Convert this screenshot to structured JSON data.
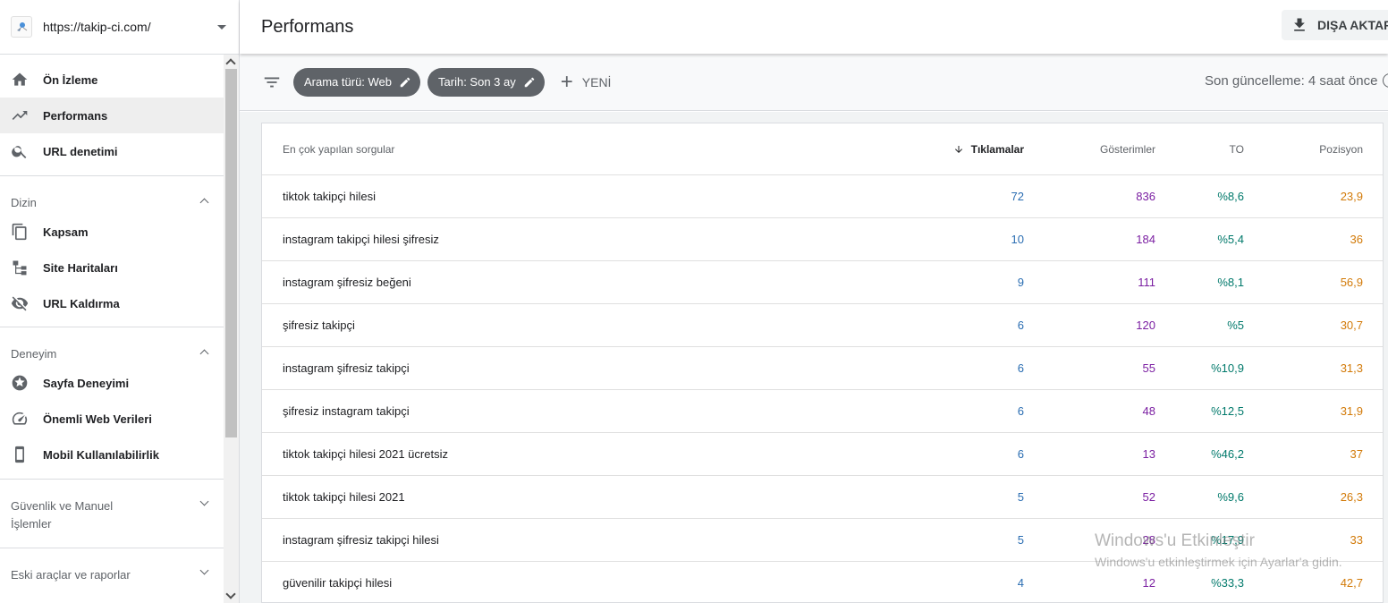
{
  "property": {
    "url": "https://takip-ci.com/"
  },
  "nav": {
    "top": [
      {
        "label": "Ön İzleme",
        "icon": "home-icon"
      },
      {
        "label": "Performans",
        "icon": "trending-icon"
      },
      {
        "label": "URL denetimi",
        "icon": "search-icon"
      }
    ],
    "sections": [
      {
        "title": "Dizin",
        "expanded": true,
        "items": [
          {
            "label": "Kapsam",
            "icon": "pages-icon"
          },
          {
            "label": "Site Haritaları",
            "icon": "sitemap-icon"
          },
          {
            "label": "URL Kaldırma",
            "icon": "eye-off-icon"
          }
        ]
      },
      {
        "title": "Deneyim",
        "expanded": true,
        "items": [
          {
            "label": "Sayfa Deneyimi",
            "icon": "star-circle-icon"
          },
          {
            "label": "Önemli Web Verileri",
            "icon": "gauge-icon"
          },
          {
            "label": "Mobil Kullanılabilirlik",
            "icon": "phone-icon"
          }
        ]
      },
      {
        "title": "Güvenlik ve Manuel İşlemler",
        "expanded": false,
        "items": []
      },
      {
        "title": "Eski araçlar ve raporlar",
        "expanded": false,
        "items": []
      }
    ]
  },
  "header": {
    "title": "Performans",
    "export_label": "DIŞA AKTAR"
  },
  "filters": {
    "chips": [
      "Arama türü: Web",
      "Tarih: Son 3 ay"
    ],
    "new_label": "YENİ",
    "updated": "Son güncelleme: 4 saat önce"
  },
  "table": {
    "headers": {
      "query": "En çok yapılan sorgular",
      "clicks": "Tıklamalar",
      "impressions": "Gösterimler",
      "ctr": "TO",
      "position": "Pozisyon"
    },
    "rows": [
      {
        "query": "tiktok takipçi hilesi",
        "clicks": "72",
        "impressions": "836",
        "ctr": "%8,6",
        "position": "23,9"
      },
      {
        "query": "instagram takipçi hilesi şifresiz",
        "clicks": "10",
        "impressions": "184",
        "ctr": "%5,4",
        "position": "36"
      },
      {
        "query": "instagram şifresiz beğeni",
        "clicks": "9",
        "impressions": "111",
        "ctr": "%8,1",
        "position": "56,9"
      },
      {
        "query": "şifresiz takipçi",
        "clicks": "6",
        "impressions": "120",
        "ctr": "%5",
        "position": "30,7"
      },
      {
        "query": "instagram şifresiz takipçi",
        "clicks": "6",
        "impressions": "55",
        "ctr": "%10,9",
        "position": "31,3"
      },
      {
        "query": "şifresiz instagram takipçi",
        "clicks": "6",
        "impressions": "48",
        "ctr": "%12,5",
        "position": "31,9"
      },
      {
        "query": "tiktok takipçi hilesi 2021 ücretsiz",
        "clicks": "6",
        "impressions": "13",
        "ctr": "%46,2",
        "position": "37"
      },
      {
        "query": "tiktok takipçi hilesi 2021",
        "clicks": "5",
        "impressions": "52",
        "ctr": "%9,6",
        "position": "26,3"
      },
      {
        "query": "instagram şifresiz takipçi hilesi",
        "clicks": "5",
        "impressions": "28",
        "ctr": "%17,9",
        "position": "33"
      },
      {
        "query": "güvenilir takipçi hilesi",
        "clicks": "4",
        "impressions": "12",
        "ctr": "%33,3",
        "position": "42,7"
      }
    ]
  },
  "watermark": {
    "line1": "Windows'u Etkinleştir",
    "line2": "Windows'u etkinleştirmek için Ayarlar'a gidin."
  },
  "colors": {
    "clicks": "#2a6db2",
    "impressions": "#7b1fa2",
    "ctr": "#00796b",
    "position": "#d27a08",
    "chip": "#5f6368"
  }
}
